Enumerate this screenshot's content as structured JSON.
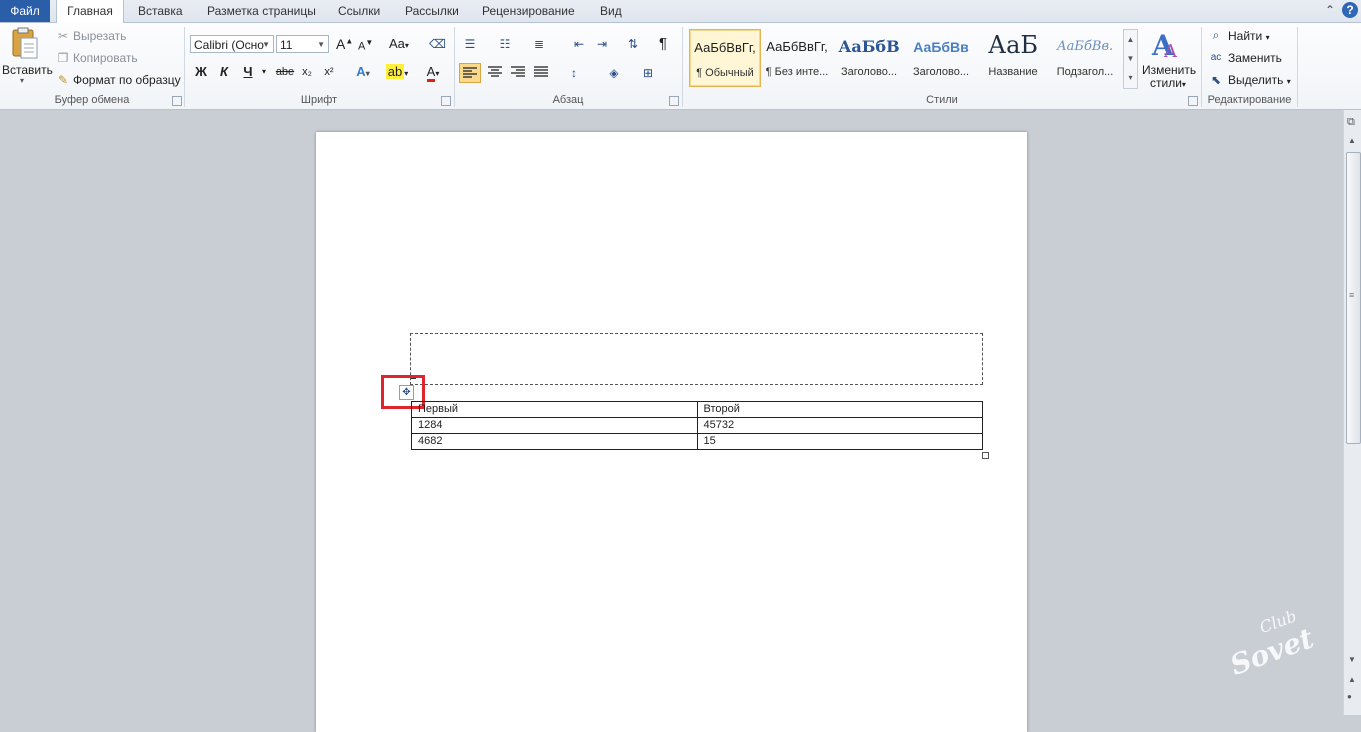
{
  "tabs": [
    "Файл",
    "Главная",
    "Вставка",
    "Разметка страницы",
    "Ссылки",
    "Рассылки",
    "Рецензирование",
    "Вид"
  ],
  "clipboard": {
    "paste_label": "Вставить",
    "cut_label": "Вырезать",
    "copy_label": "Копировать",
    "format_painter_label": "Формат по образцу",
    "group_label": "Буфер обмена"
  },
  "font": {
    "family_value": "Calibri (Осно",
    "size_value": "11",
    "case_label": "Aa",
    "bold": "Ж",
    "italic": "К",
    "underline": "Ч",
    "strike": "abe",
    "subscript": "x₂",
    "superscript": "x²",
    "grow": "A",
    "shrink": "A",
    "color_letter": "A",
    "group_label": "Шрифт"
  },
  "paragraph": {
    "group_label": "Абзац",
    "pilcrow": "¶"
  },
  "styles": {
    "items": [
      {
        "sample": "АаБбВвГг,",
        "name": "¶ Обычный"
      },
      {
        "sample": "АаБбВвГг,",
        "name": "¶ Без инте..."
      },
      {
        "sample": "АаБбВ",
        "name": "Заголово..."
      },
      {
        "sample": "АаБбВв",
        "name": "Заголово..."
      },
      {
        "sample": "АаБ",
        "name": "Название"
      },
      {
        "sample": "АаБбВв.",
        "name": "Подзагол..."
      }
    ],
    "change_label_1": "Изменить",
    "change_label_2": "стили",
    "group_label": "Стили"
  },
  "editing": {
    "find_label": "Найти",
    "replace_label": "Заменить",
    "select_label": "Выделить",
    "group_label": "Редактирование"
  },
  "table": {
    "rows": [
      [
        "Первый",
        "Второй"
      ],
      [
        "1284",
        "45732"
      ],
      [
        "4682",
        "15"
      ]
    ]
  },
  "watermark": {
    "line1": "Club",
    "line2": "Sovet"
  }
}
